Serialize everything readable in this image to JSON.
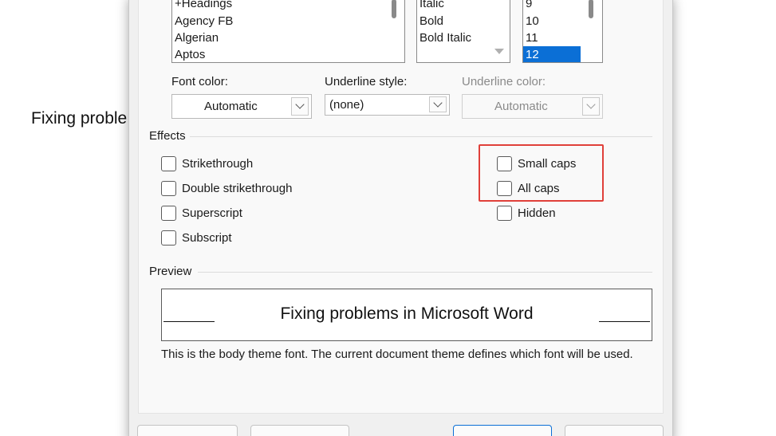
{
  "document": {
    "visible_text": "Fixing proble"
  },
  "font_dialog": {
    "font_list": {
      "items": [
        "+Headings",
        "Agency FB",
        "Algerian",
        "Aptos"
      ]
    },
    "style_list": {
      "items": [
        "Italic",
        "Bold",
        "Bold Italic"
      ]
    },
    "size_list": {
      "items": [
        "9",
        "10",
        "11",
        "12"
      ],
      "selected": "12"
    },
    "font_color": {
      "label": "Font color:",
      "value": "Automatic"
    },
    "underline_style": {
      "label": "Underline style:",
      "value": "(none)"
    },
    "underline_color": {
      "label": "Underline color:",
      "value": "Automatic",
      "disabled": true
    },
    "effects": {
      "title": "Effects",
      "strikethrough": "Strikethrough",
      "double_strikethrough": "Double strikethrough",
      "superscript": "Superscript",
      "subscript": "Subscript",
      "small_caps": "Small caps",
      "all_caps": "All caps",
      "hidden": "Hidden"
    },
    "preview": {
      "title": "Preview",
      "sample_text": "Fixing problems in Microsoft Word",
      "note": "This is the body theme font. The current document theme defines which font will be used."
    }
  },
  "colors": {
    "selection": "#0b6fd6",
    "highlight_annotation": "#e0403a"
  }
}
